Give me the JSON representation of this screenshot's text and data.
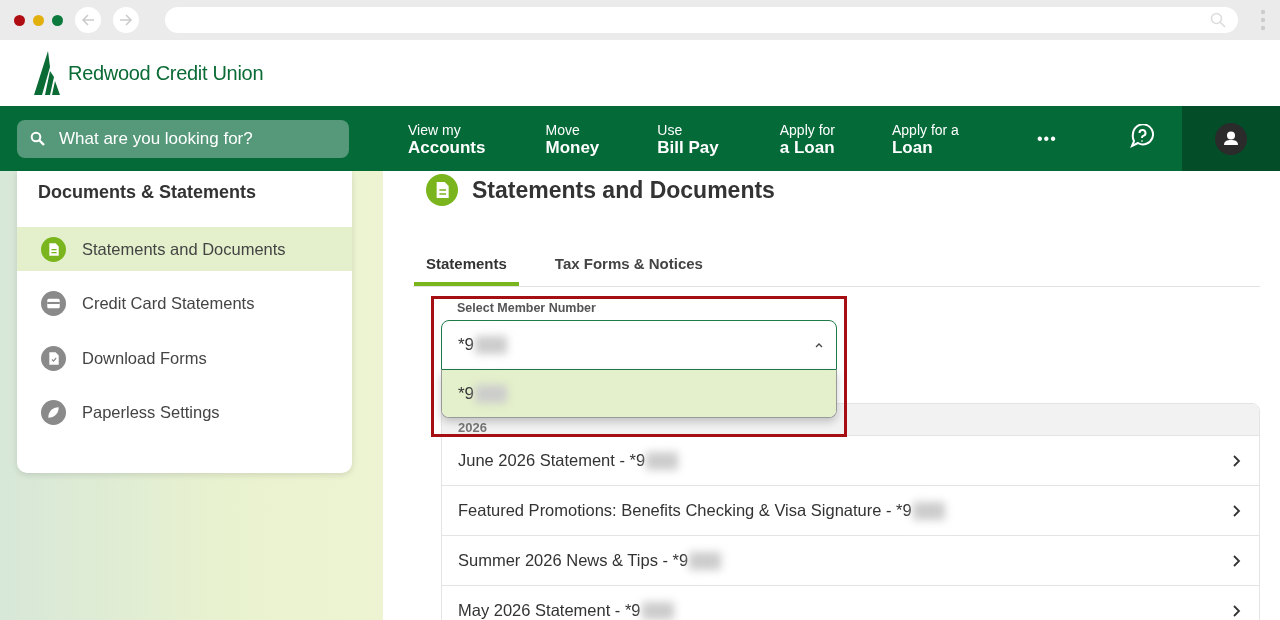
{
  "header": {
    "logo": "Redwood Credit Union"
  },
  "nav": {
    "search": {
      "placeholder": "What are you looking for?"
    },
    "items": [
      {
        "line1": "View my",
        "line2": "Accounts"
      },
      {
        "line1": "Move",
        "line2": "Money"
      },
      {
        "line1": "Use",
        "line2": "Bill Pay"
      },
      {
        "line1": "Apply for",
        "line2": "a Loan"
      },
      {
        "line1": "Apply for a",
        "line2": "Loan"
      }
    ],
    "more": "•••"
  },
  "sidebar": {
    "title": "Documents & Statements",
    "items": [
      {
        "label": "Statements and Documents",
        "kind": "document",
        "selected": true
      },
      {
        "label": "Credit Card Statements",
        "kind": "card",
        "selected": false
      },
      {
        "label": "Download Forms",
        "kind": "form",
        "selected": false
      },
      {
        "label": "Paperless Settings",
        "kind": "leaf",
        "selected": false
      }
    ]
  },
  "main": {
    "title": "Statements and Documents",
    "tabs": [
      {
        "label": "Statements",
        "selected": true
      },
      {
        "label": "Tax Forms & Notices",
        "selected": false
      }
    ],
    "member_select": {
      "label": "Select Member Number",
      "value": "*9",
      "redacted": true,
      "expanded": true,
      "options": [
        {
          "text": "*9",
          "redacted": true,
          "selected": true
        }
      ]
    },
    "statements": {
      "group": "2026",
      "rows": [
        {
          "text": "June 2026 Statement - *9",
          "redacted": true
        },
        {
          "text": "Featured Promotions: Benefits Checking & Visa Signature - *9",
          "redacted": true
        },
        {
          "text": "Summer 2026 News & Tips - *9",
          "redacted": true
        },
        {
          "text": "May 2026 Statement - *9",
          "redacted": true
        }
      ]
    }
  }
}
